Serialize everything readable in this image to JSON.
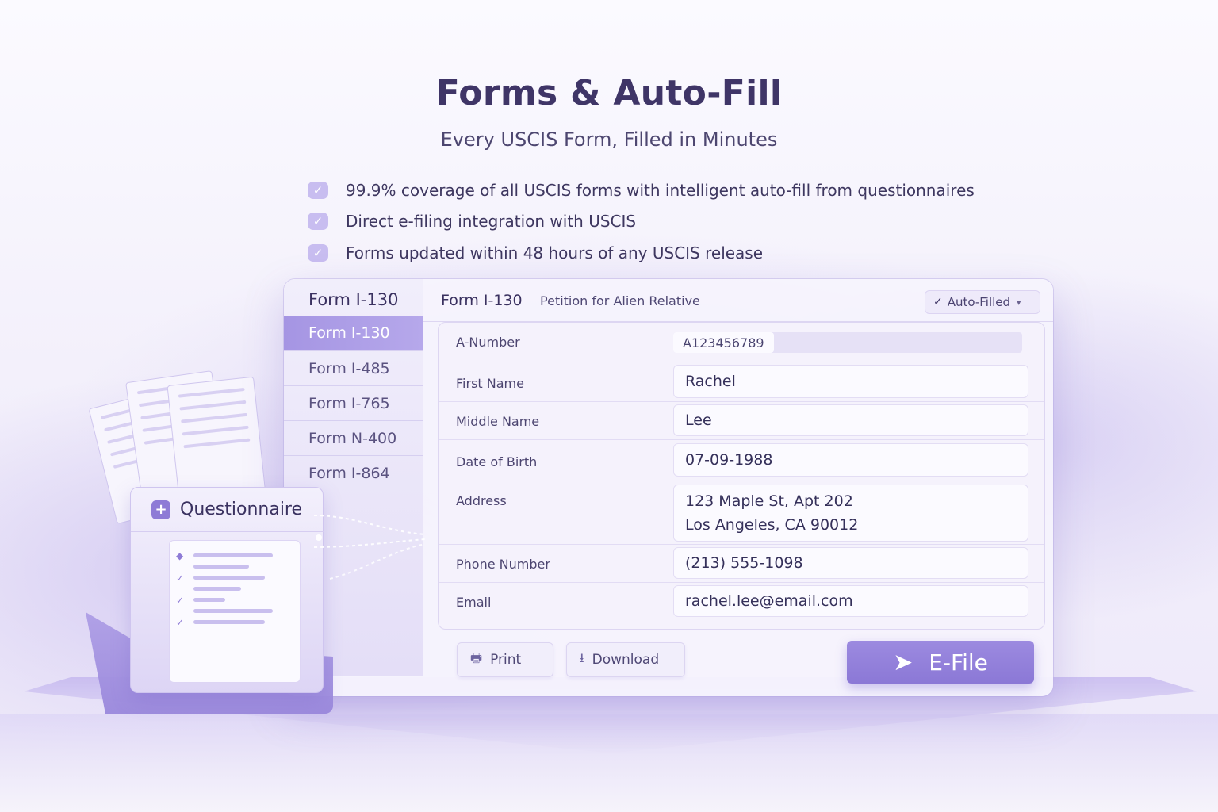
{
  "header": {
    "title": "Forms & Auto-Fill",
    "subtitle": "Every USCIS Form, Filled in Minutes"
  },
  "features": [
    "99.9% coverage of all USCIS forms with intelligent auto-fill from questionnaires",
    "Direct e-filing integration with USCIS",
    "Forms updated within 48 hours of any USCIS release"
  ],
  "sidebar": {
    "title": "Form I-130",
    "items": [
      {
        "label": "Form I-130",
        "active": true
      },
      {
        "label": "Form I-485",
        "active": false
      },
      {
        "label": "Form I-765",
        "active": false
      },
      {
        "label": "Form N-400",
        "active": false
      },
      {
        "label": "Form I-864",
        "active": false
      }
    ]
  },
  "panel": {
    "form_name": "Form I-130",
    "form_desc": "Petition for Alien Relative",
    "status_label": "Auto-Filled",
    "fields": {
      "a_number": {
        "label": "A-Number",
        "value": "A123456789"
      },
      "first_name": {
        "label": "First Name",
        "value": "Rachel"
      },
      "middle_name": {
        "label": "Middle Name",
        "value": "Lee"
      },
      "dob": {
        "label": "Date of Birth",
        "value": "07-09-1988"
      },
      "address": {
        "label": "Address",
        "line1": "123 Maple St, Apt 202",
        "line2": "Los Angeles, CA 90012"
      },
      "phone": {
        "label": "Phone Number",
        "value": "(213) 555-1098"
      },
      "email": {
        "label": "Email",
        "value": "rachel.lee@email.com"
      }
    },
    "buttons": {
      "print": "Print",
      "download": "Download",
      "efile": "E-File"
    }
  },
  "questionnaire": {
    "title": "Questionnaire"
  },
  "colors": {
    "accent": "#8e7bd6",
    "accent_light": "#c8bdf0",
    "text_dark": "#3f3567"
  }
}
